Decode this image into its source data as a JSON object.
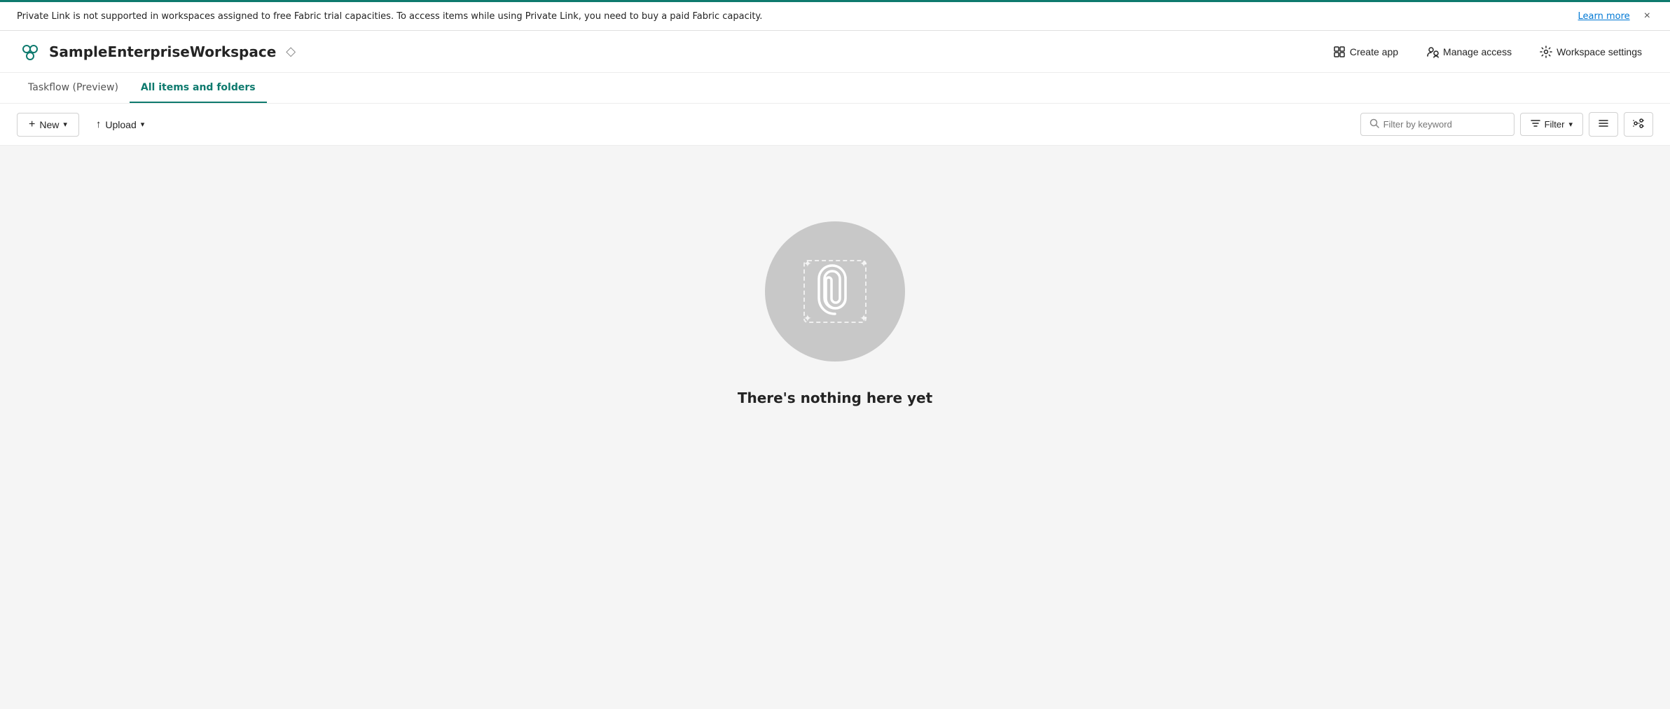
{
  "banner": {
    "message": "Private Link is not supported in workspaces assigned to free Fabric trial capacities. To access items while using Private Link, you need to buy a paid Fabric capacity.",
    "learn_more_label": "Learn more",
    "close_label": "×"
  },
  "header": {
    "workspace_name": "SampleEnterpriseWorkspace",
    "diamond_icon": "◇",
    "create_app_label": "Create app",
    "manage_access_label": "Manage access",
    "workspace_settings_label": "Workspace settings"
  },
  "tabs": [
    {
      "id": "taskflow",
      "label": "Taskflow (Preview)",
      "active": false
    },
    {
      "id": "all-items",
      "label": "All items and folders",
      "active": true
    }
  ],
  "toolbar": {
    "new_label": "New",
    "upload_label": "Upload",
    "filter_placeholder": "Filter by keyword",
    "filter_label": "Filter",
    "plus_icon": "+",
    "chevron_down": "▾",
    "upload_icon": "↑"
  },
  "empty_state": {
    "title": "There's nothing here yet"
  }
}
